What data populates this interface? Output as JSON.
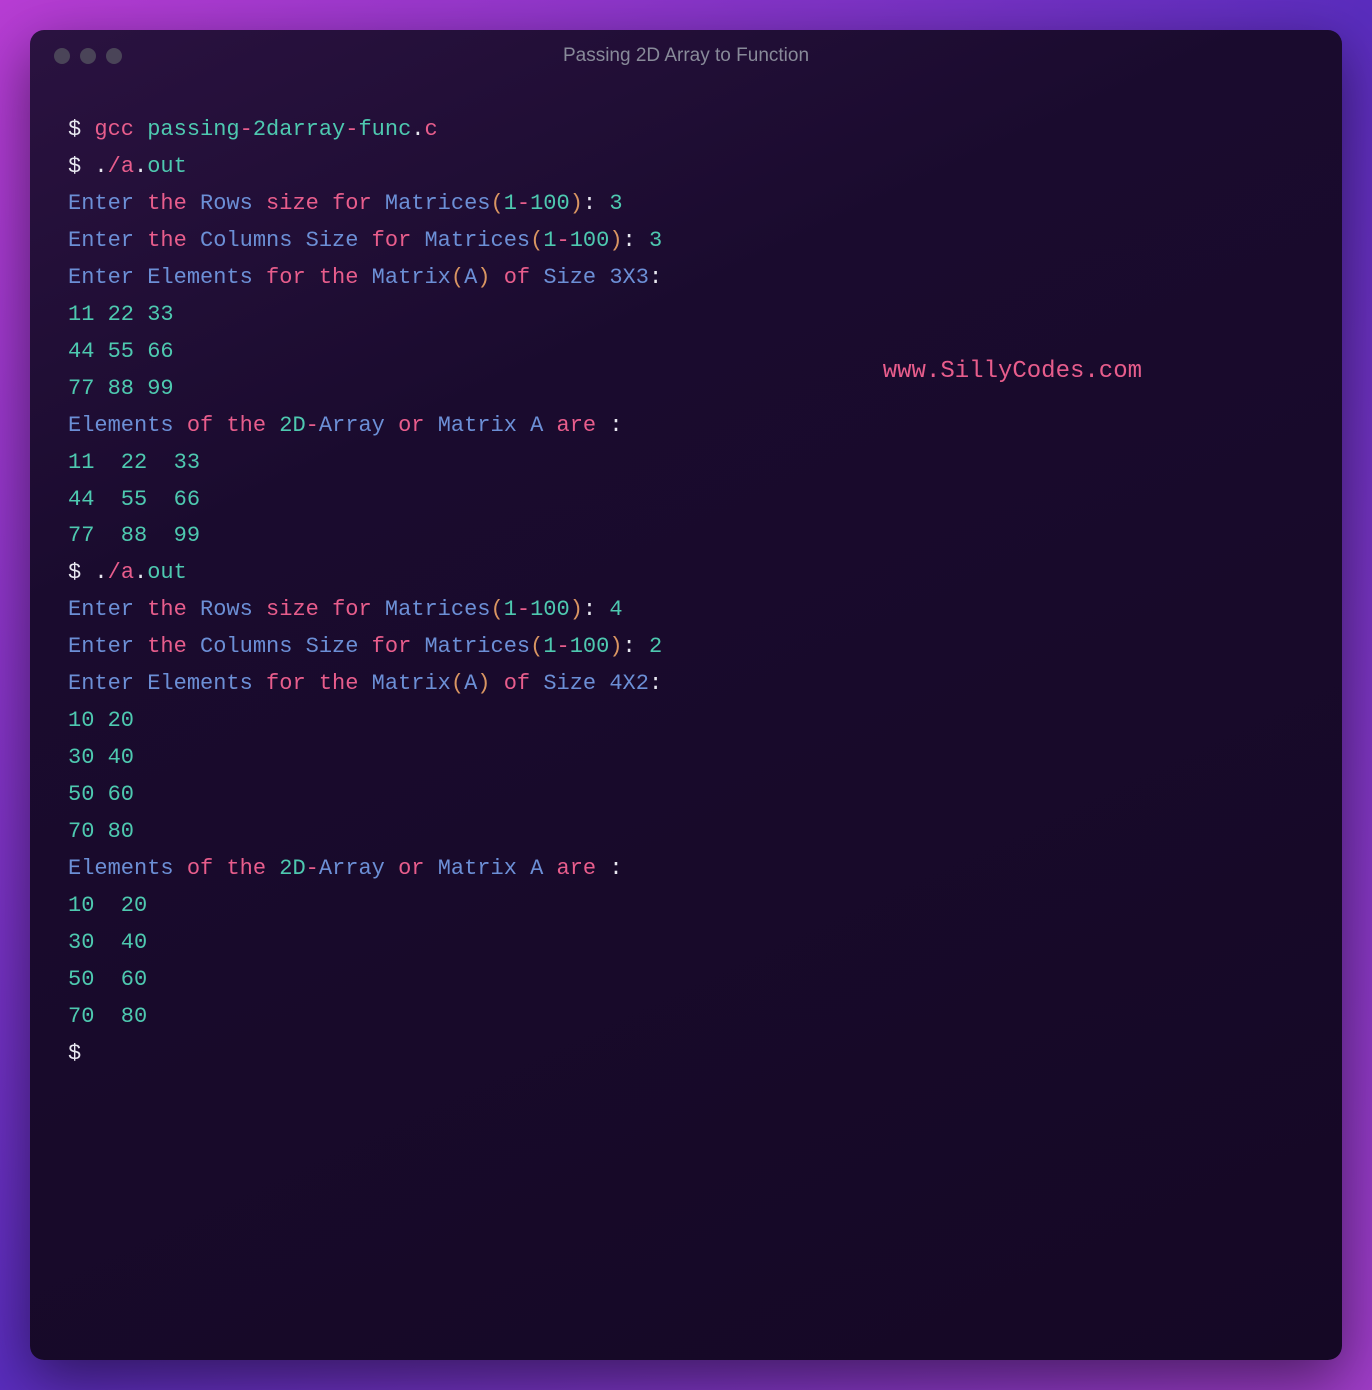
{
  "window": {
    "title": "Passing 2D Array to Function"
  },
  "watermark": "www.SillyCodes.com",
  "terminal": {
    "l1": {
      "prompt": "$ ",
      "cmd": "gcc",
      "sp1": " passing",
      "dash1": "-",
      "seg2": "2darray",
      "dash2": "-",
      "seg3": "func",
      "dot": ".",
      "ext": "c"
    },
    "l2": {
      "prompt": "$ ",
      "dot": ".",
      "slash": "/",
      "a": "a",
      "dot2": ".",
      "out": "out"
    },
    "l3": {
      "w1": "Enter",
      "sp1": " ",
      "w2": "the",
      "sp2": " ",
      "w3": "Rows",
      "sp3": " ",
      "w4": "size",
      "sp4": " ",
      "w5": "for",
      "sp5": " ",
      "w6": "Matrices",
      "p1": "(",
      "w7": "1",
      "dash": "-",
      "w8": "100",
      "p2": ")",
      "colon": ":",
      "sp6": " ",
      "val": "3"
    },
    "l4": {
      "w1": "Enter",
      "sp1": " ",
      "w2": "the",
      "sp2": " ",
      "w3": "Columns",
      "sp3": " ",
      "w4": "Size",
      "sp4": " ",
      "w5": "for",
      "sp5": " ",
      "w6": "Matrices",
      "p1": "(",
      "w7": "1",
      "dash": "-",
      "w8": "100",
      "p2": ")",
      "colon": ":",
      "sp6": " ",
      "val": "3"
    },
    "l5": {
      "w1": "Enter",
      "sp1": " ",
      "w2": "Elements",
      "sp2": " ",
      "w3": "for",
      "sp3": " ",
      "w4": "the",
      "sp4": " ",
      "w5": "Matrix",
      "p1": "(",
      "w6": "A",
      "p2": ")",
      "sp5": " ",
      "w7": "of",
      "sp6": " ",
      "w8": "Size",
      "sp7": " ",
      "w9": "3X3",
      "colon": ":"
    },
    "l6": "11 22 33",
    "l7": "44 55 66",
    "l8": "77 88 99",
    "l9": {
      "w1": "Elements",
      "sp1": " ",
      "w2": "of",
      "sp2": " ",
      "w3": "the",
      "sp3": " ",
      "w4": "2D",
      "dash": "-",
      "w5": "Array",
      "sp4": " ",
      "w6": "or",
      "sp5": " ",
      "w7": "Matrix",
      "sp6": " ",
      "w8": "A",
      "sp7": " ",
      "w9": "are",
      "sp8": " ",
      "colon": ":"
    },
    "l10": "11  22  33",
    "l11": "44  55  66",
    "l12": "77  88  99",
    "l13": {
      "prompt": "$ ",
      "dot": ".",
      "slash": "/",
      "a": "a",
      "dot2": ".",
      "out": "out"
    },
    "l14": {
      "w1": "Enter",
      "sp1": " ",
      "w2": "the",
      "sp2": " ",
      "w3": "Rows",
      "sp3": " ",
      "w4": "size",
      "sp4": " ",
      "w5": "for",
      "sp5": " ",
      "w6": "Matrices",
      "p1": "(",
      "w7": "1",
      "dash": "-",
      "w8": "100",
      "p2": ")",
      "colon": ":",
      "sp6": " ",
      "val": "4"
    },
    "l15": {
      "w1": "Enter",
      "sp1": " ",
      "w2": "the",
      "sp2": " ",
      "w3": "Columns",
      "sp3": " ",
      "w4": "Size",
      "sp4": " ",
      "w5": "for",
      "sp5": " ",
      "w6": "Matrices",
      "p1": "(",
      "w7": "1",
      "dash": "-",
      "w8": "100",
      "p2": ")",
      "colon": ":",
      "sp6": " ",
      "val": "2"
    },
    "l16": {
      "w1": "Enter",
      "sp1": " ",
      "w2": "Elements",
      "sp2": " ",
      "w3": "for",
      "sp3": " ",
      "w4": "the",
      "sp4": " ",
      "w5": "Matrix",
      "p1": "(",
      "w6": "A",
      "p2": ")",
      "sp5": " ",
      "w7": "of",
      "sp6": " ",
      "w8": "Size",
      "sp7": " ",
      "w9": "4X2",
      "colon": ":"
    },
    "l17": "10 20",
    "l18": "30 40",
    "l19": "50 60",
    "l20": "70 80",
    "l21": {
      "w1": "Elements",
      "sp1": " ",
      "w2": "of",
      "sp2": " ",
      "w3": "the",
      "sp3": " ",
      "w4": "2D",
      "dash": "-",
      "w5": "Array",
      "sp4": " ",
      "w6": "or",
      "sp5": " ",
      "w7": "Matrix",
      "sp6": " ",
      "w8": "A",
      "sp7": " ",
      "w9": "are",
      "sp8": " ",
      "colon": ":"
    },
    "l22": "10  20",
    "l23": "30  40",
    "l24": "50  60",
    "l25": "70  80",
    "l26": "$ "
  }
}
